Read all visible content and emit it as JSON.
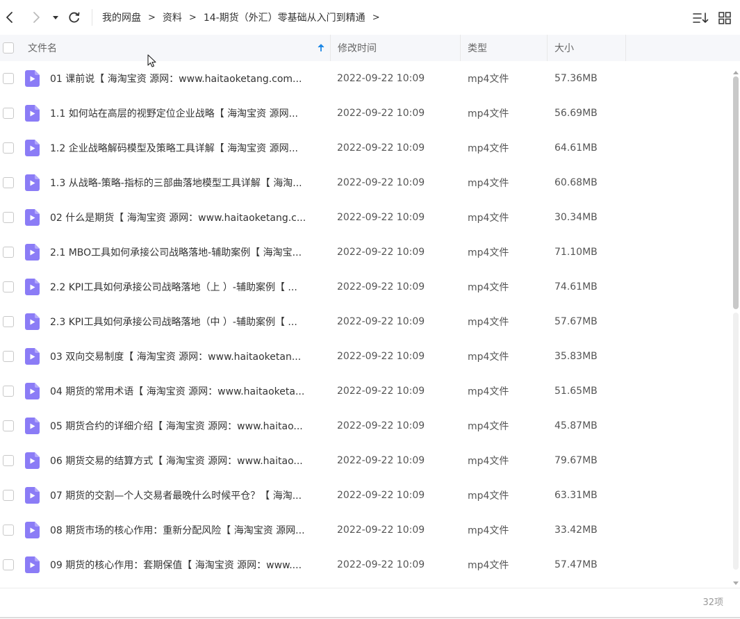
{
  "toolbar": {
    "icons": [
      "back-icon",
      "forward-icon",
      "dropdown-icon",
      "refresh-icon",
      "sort-list-icon",
      "grid-view-icon"
    ],
    "breadcrumbs": [
      "我的网盘",
      "资料",
      "14-期货（外汇）零基础从入门到精通"
    ],
    "separator": ">"
  },
  "header": {
    "name": "文件名",
    "modified": "修改时间",
    "type": "类型",
    "size": "大小"
  },
  "files": [
    {
      "name": "01 课前说【 海淘宝资 源网：www.haitaoketang.com...",
      "time": "2022-09-22 10:09",
      "type": "mp4文件",
      "size": "57.36MB"
    },
    {
      "name": "1.1 如何站在高层的视野定位企业战略【 海淘宝资 源网...",
      "time": "2022-09-22 10:09",
      "type": "mp4文件",
      "size": "56.69MB"
    },
    {
      "name": "1.2 企业战略解码模型及策略工具详解【 海淘宝资 源网...",
      "time": "2022-09-22 10:09",
      "type": "mp4文件",
      "size": "64.61MB"
    },
    {
      "name": "1.3 从战略-策略-指标的三部曲落地模型工具详解【 海淘...",
      "time": "2022-09-22 10:09",
      "type": "mp4文件",
      "size": "60.68MB"
    },
    {
      "name": "02 什么是期货【 海淘宝资 源网：www.haitaoketang.c...",
      "time": "2022-09-22 10:09",
      "type": "mp4文件",
      "size": "30.34MB"
    },
    {
      "name": "2.1  MBO工具如何承接公司战略落地-辅助案例【 海淘宝...",
      "time": "2022-09-22 10:09",
      "type": "mp4文件",
      "size": "71.10MB"
    },
    {
      "name": "2.2  KPI工具如何承接公司战略落地（上 ）-辅助案例【 ...",
      "time": "2022-09-22 10:09",
      "type": "mp4文件",
      "size": "74.61MB"
    },
    {
      "name": "2.3  KPI工具如何承接公司战略落地（中 ）-辅助案例【 ...",
      "time": "2022-09-22 10:09",
      "type": "mp4文件",
      "size": "57.67MB"
    },
    {
      "name": "03 双向交易制度【 海淘宝资 源网：www.haitaoketan...",
      "time": "2022-09-22 10:09",
      "type": "mp4文件",
      "size": "35.83MB"
    },
    {
      "name": "04 期货的常用术语【 海淘宝资 源网：www.haitaoketa...",
      "time": "2022-09-22 10:09",
      "type": "mp4文件",
      "size": "51.65MB"
    },
    {
      "name": "05 期货合约的详细介绍【 海淘宝资 源网：www.haitao...",
      "time": "2022-09-22 10:09",
      "type": "mp4文件",
      "size": "45.87MB"
    },
    {
      "name": "06 期货交易的结算方式【 海淘宝资 源网：www.haitao...",
      "time": "2022-09-22 10:09",
      "type": "mp4文件",
      "size": "79.67MB"
    },
    {
      "name": "07 期货的交割—个人交易者最晚什么时候平仓？【 海淘...",
      "time": "2022-09-22 10:09",
      "type": "mp4文件",
      "size": "63.31MB"
    },
    {
      "name": "08 期货市场的核心作用：重新分配风险【 海淘宝资 源网...",
      "time": "2022-09-22 10:09",
      "type": "mp4文件",
      "size": "33.42MB"
    },
    {
      "name": "09 期货的核心作用：套期保值【 海淘宝资 源网：www....",
      "time": "2022-09-22 10:09",
      "type": "mp4文件",
      "size": "57.47MB"
    }
  ],
  "footer": {
    "count": "32项"
  },
  "colors": {
    "file_icon": "#8b7cf6",
    "sort_arrow": "#1e88e5",
    "header_bg": "#f6f7fa"
  }
}
